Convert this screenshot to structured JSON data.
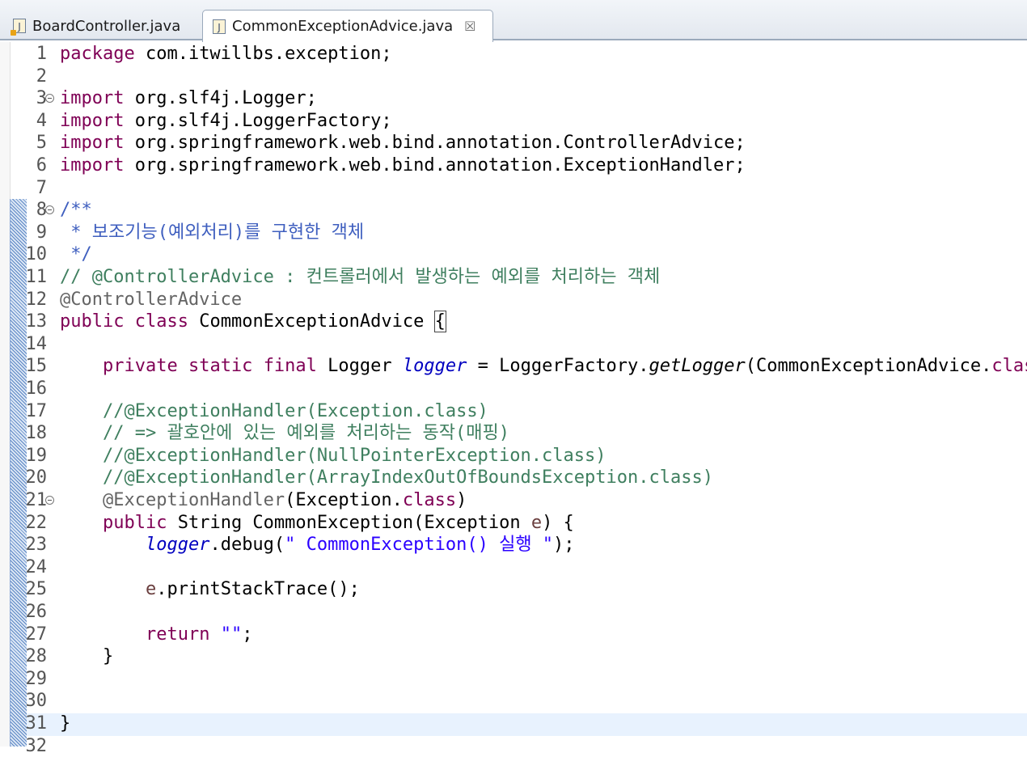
{
  "tabs": [
    {
      "label": "BoardController.java",
      "active": false
    },
    {
      "label": "CommonExceptionAdvice.java",
      "active": true,
      "close": "☒"
    }
  ],
  "editor": {
    "line_numbers": [
      "1",
      "2",
      "3",
      "4",
      "5",
      "6",
      "7",
      "8",
      "9",
      "10",
      "11",
      "12",
      "13",
      "14",
      "15",
      "16",
      "17",
      "18",
      "19",
      "20",
      "21",
      "22",
      "23",
      "24",
      "25",
      "26",
      "27",
      "28",
      "29",
      "30",
      "31",
      "32"
    ],
    "fold_lines": [
      3,
      8,
      21
    ],
    "current_line": 31,
    "lines": [
      [
        {
          "t": "package",
          "c": "kw"
        },
        {
          "t": " com.itwillbs.exception;"
        }
      ],
      [],
      [
        {
          "t": "import",
          "c": "kw"
        },
        {
          "t": " org.slf4j.Logger;"
        }
      ],
      [
        {
          "t": "import",
          "c": "kw"
        },
        {
          "t": " org.slf4j.LoggerFactory;"
        }
      ],
      [
        {
          "t": "import",
          "c": "kw"
        },
        {
          "t": " org.springframework.web.bind.annotation.ControllerAdvice;"
        }
      ],
      [
        {
          "t": "import",
          "c": "kw"
        },
        {
          "t": " org.springframework.web.bind.annotation.ExceptionHandler;"
        }
      ],
      [],
      [
        {
          "t": "/**",
          "c": "jd"
        }
      ],
      [
        {
          "t": " * 보조기능(예외처리)를 구현한 객체",
          "c": "jd"
        }
      ],
      [
        {
          "t": " */",
          "c": "jd"
        }
      ],
      [
        {
          "t": "// @ControllerAdvice : 컨트롤러에서 발생하는 예외를 처리하는 객체",
          "c": "cm"
        }
      ],
      [
        {
          "t": "@ControllerAdvice",
          "c": "an"
        }
      ],
      [
        {
          "t": "public",
          "c": "kw"
        },
        {
          "t": " "
        },
        {
          "t": "class",
          "c": "kw"
        },
        {
          "t": " CommonExceptionAdvice "
        },
        {
          "t": "{",
          "c": "bracket"
        }
      ],
      [],
      [
        {
          "t": "    "
        },
        {
          "t": "private",
          "c": "kw"
        },
        {
          "t": " "
        },
        {
          "t": "static",
          "c": "kw"
        },
        {
          "t": " "
        },
        {
          "t": "final",
          "c": "kw"
        },
        {
          "t": " Logger "
        },
        {
          "t": "logger",
          "c": "fld"
        },
        {
          "t": " = LoggerFactory."
        },
        {
          "t": "getLogger",
          "c": "st"
        },
        {
          "t": "(CommonExceptionAdvice."
        },
        {
          "t": "class",
          "c": "kw"
        },
        {
          "t": ");"
        }
      ],
      [],
      [
        {
          "t": "    //@ExceptionHandler(Exception.class)",
          "c": "cm"
        }
      ],
      [
        {
          "t": "    // => 괄호안에 있는 예외를 처리하는 동작(매핑)",
          "c": "cm"
        }
      ],
      [
        {
          "t": "    //@ExceptionHandler(NullPointerException.class)",
          "c": "cm"
        }
      ],
      [
        {
          "t": "    //@ExceptionHandler(ArrayIndexOutOfBoundsException.class)",
          "c": "cm"
        }
      ],
      [
        {
          "t": "    "
        },
        {
          "t": "@ExceptionHandler",
          "c": "an"
        },
        {
          "t": "(Exception."
        },
        {
          "t": "class",
          "c": "kw"
        },
        {
          "t": ")"
        }
      ],
      [
        {
          "t": "    "
        },
        {
          "t": "public",
          "c": "kw"
        },
        {
          "t": " String CommonException(Exception "
        },
        {
          "t": "e",
          "c": "var"
        },
        {
          "t": ") {"
        }
      ],
      [
        {
          "t": "        "
        },
        {
          "t": "logger",
          "c": "fld"
        },
        {
          "t": ".debug("
        },
        {
          "t": "\" CommonException() 실행 \"",
          "c": "str"
        },
        {
          "t": ");"
        }
      ],
      [],
      [
        {
          "t": "        "
        },
        {
          "t": "e",
          "c": "var"
        },
        {
          "t": ".printStackTrace();"
        }
      ],
      [],
      [
        {
          "t": "        "
        },
        {
          "t": "return",
          "c": "kw"
        },
        {
          "t": " "
        },
        {
          "t": "\"\"",
          "c": "str"
        },
        {
          "t": ";"
        }
      ],
      [
        {
          "t": "    }"
        }
      ],
      [],
      [],
      [
        {
          "t": "}"
        }
      ],
      []
    ]
  }
}
